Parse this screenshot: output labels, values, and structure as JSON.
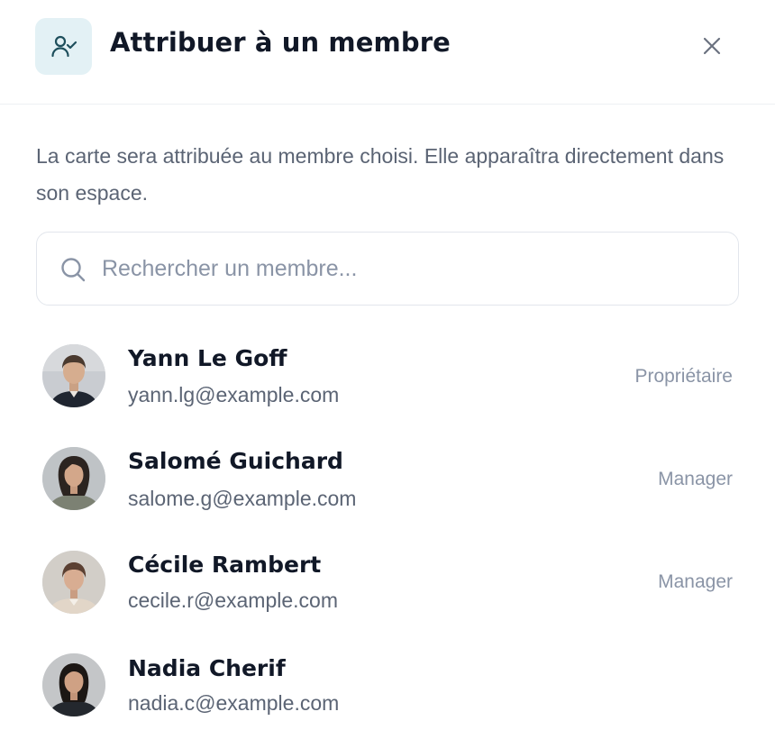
{
  "header": {
    "title": "Attribuer à un membre",
    "icon": "user-check-icon",
    "close_icon": "close-icon",
    "icon_bg": "#e3f1f5",
    "icon_color": "#1e4f5c"
  },
  "description": "La carte sera attribuée au membre choisi. Elle apparaîtra directement dans son espace.",
  "search": {
    "placeholder": "Rechercher un membre...",
    "value": "",
    "icon": "search-icon"
  },
  "members": [
    {
      "name": "Yann Le Goff",
      "email": "yann.lg@example.com",
      "role": "Propriétaire"
    },
    {
      "name": "Salomé Guichard",
      "email": "salome.g@example.com",
      "role": "Manager"
    },
    {
      "name": "Cécile Rambert",
      "email": "cecile.r@example.com",
      "role": "Manager"
    },
    {
      "name": "Nadia Cherif",
      "email": "nadia.c@example.com",
      "role": ""
    }
  ]
}
